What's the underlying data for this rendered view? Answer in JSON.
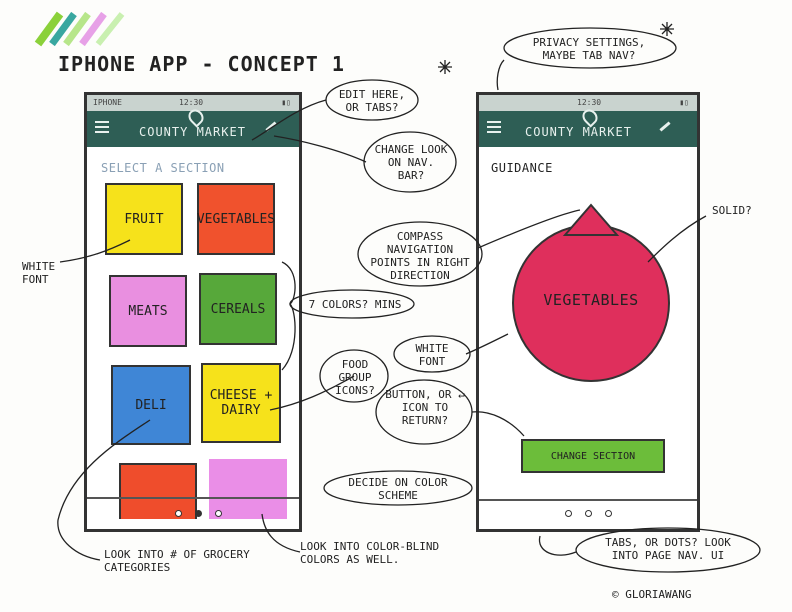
{
  "page": {
    "title": "IPHONE APP - CONCEPT 1",
    "credit": "© GLORIAWANG"
  },
  "colors": {
    "nav": "#2e5e55",
    "fruit": "#f6e21b",
    "vegetables": "#f0522d",
    "meats": "#e98fe0",
    "cereals": "#57a83a",
    "deli": "#3f86d6",
    "cheese": "#f6e21b",
    "bottom_left": "#ef4d2c",
    "bottom_right": "#ea8ee7",
    "compass": "#df2f5c",
    "change_btn": "#6cbd3a"
  },
  "phone1": {
    "carrier": "IPHONE",
    "time": "12:30",
    "market": "COUNTY MARKET",
    "section_heading": "SELECT A SECTION",
    "tiles": [
      "FRUIT",
      "VEGETABLES",
      "MEATS",
      "CEREALS",
      "DELI",
      "CHEESE + DAIRY"
    ]
  },
  "phone2": {
    "time": "12:30",
    "market": "COUNTY MARKET",
    "heading": "GUIDANCE",
    "compass_label": "VEGETABLES",
    "button_label": "CHANGE SECTION"
  },
  "notes": {
    "edit_here": "EDIT HERE, OR TABS?",
    "privacy": "PRIVACY SETTINGS, MAYBE TAB NAV?",
    "change_look": "CHANGE LOOK ON NAV. BAR?",
    "compass_nav": "COMPASS NAVIGATION POINTS IN RIGHT DIRECTION",
    "solid": "SOLID?",
    "white_font_left": "WHITE FONT",
    "seven_colors": "7 COLORS? MINS",
    "food_icons": "FOOD GROUP ICONS?",
    "white_font_right": "WHITE FONT",
    "button_or_icon": "BUTTON, OR ↵ ICON TO RETURN?",
    "decide_color": "DECIDE ON COLOR SCHEME",
    "look_categories": "LOOK INTO # OF GROCERY CATEGORIES",
    "look_colorblind": "LOOK INTO COLOR-BLIND COLORS AS WELL.",
    "tabs_dots": "TABS, OR DOTS? LOOK INTO PAGE NAV. UI"
  }
}
